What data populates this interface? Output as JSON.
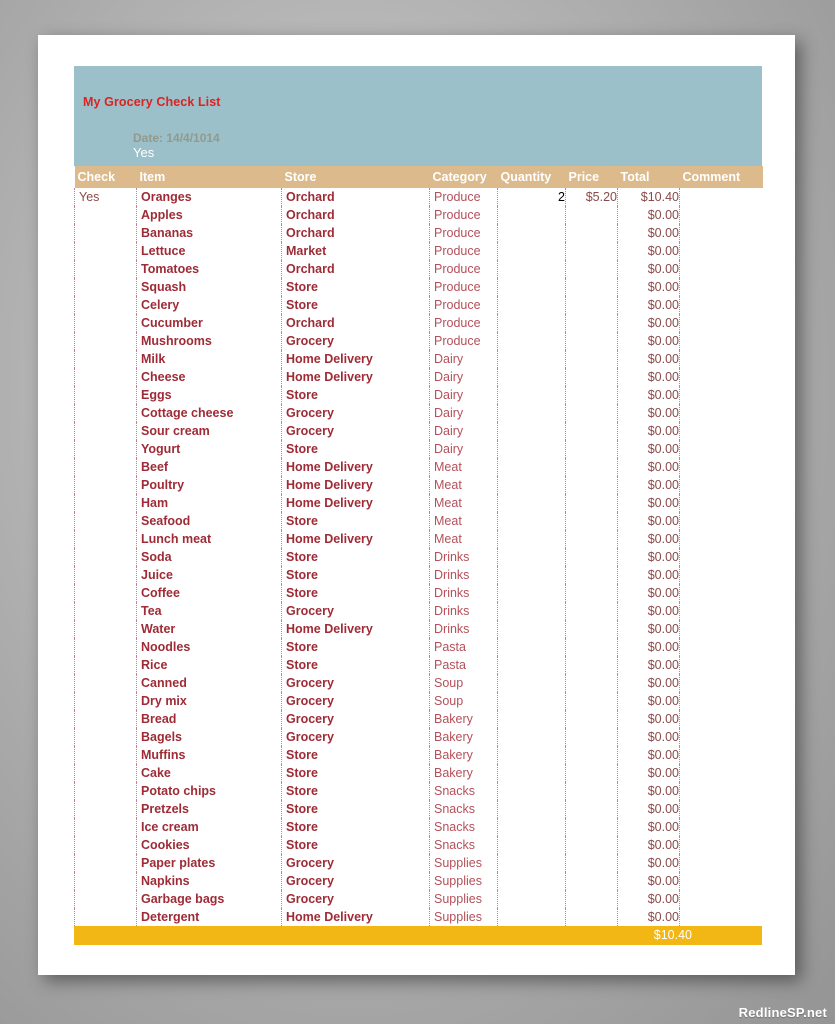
{
  "document": {
    "title": "My Grocery Check List",
    "date_label": "Date: 14/4/1014",
    "default_check": "Yes"
  },
  "colors": {
    "title_band": "#9bc0ca",
    "column_header_band": "#dcba8c",
    "total_bar": "#f2b714",
    "title_text": "#dd2222",
    "item_text": "#9e2b36",
    "category_text": "#b5505a",
    "page": "#ffffff",
    "backdrop": "#b8b8b8"
  },
  "table": {
    "columns": [
      {
        "key": "check",
        "label": "Check",
        "align": "left"
      },
      {
        "key": "item",
        "label": "Item",
        "align": "left"
      },
      {
        "key": "store",
        "label": "Store",
        "align": "left"
      },
      {
        "key": "category",
        "label": "Category",
        "align": "left"
      },
      {
        "key": "quantity",
        "label": "Quantity",
        "align": "right"
      },
      {
        "key": "price",
        "label": "Price",
        "align": "right"
      },
      {
        "key": "total",
        "label": "Total",
        "align": "right"
      },
      {
        "key": "comment",
        "label": "Comment",
        "align": "right"
      }
    ],
    "rows": [
      {
        "check": "Yes",
        "item": "Oranges",
        "store": "Orchard",
        "category": "Produce",
        "quantity": "2",
        "price": "$5.20",
        "total": "$10.40",
        "comment": ""
      },
      {
        "check": "",
        "item": "Apples",
        "store": "Orchard",
        "category": "Produce",
        "quantity": "",
        "price": "",
        "total": "$0.00",
        "comment": ""
      },
      {
        "check": "",
        "item": "Bananas",
        "store": "Orchard",
        "category": "Produce",
        "quantity": "",
        "price": "",
        "total": "$0.00",
        "comment": ""
      },
      {
        "check": "",
        "item": "Lettuce",
        "store": "Market",
        "category": "Produce",
        "quantity": "",
        "price": "",
        "total": "$0.00",
        "comment": ""
      },
      {
        "check": "",
        "item": "Tomatoes",
        "store": "Orchard",
        "category": "Produce",
        "quantity": "",
        "price": "",
        "total": "$0.00",
        "comment": ""
      },
      {
        "check": "",
        "item": "Squash",
        "store": "Store",
        "category": "Produce",
        "quantity": "",
        "price": "",
        "total": "$0.00",
        "comment": ""
      },
      {
        "check": "",
        "item": "Celery",
        "store": "Store",
        "category": "Produce",
        "quantity": "",
        "price": "",
        "total": "$0.00",
        "comment": ""
      },
      {
        "check": "",
        "item": "Cucumber",
        "store": "Orchard",
        "category": "Produce",
        "quantity": "",
        "price": "",
        "total": "$0.00",
        "comment": ""
      },
      {
        "check": "",
        "item": "Mushrooms",
        "store": "Grocery",
        "category": "Produce",
        "quantity": "",
        "price": "",
        "total": "$0.00",
        "comment": ""
      },
      {
        "check": "",
        "item": "Milk",
        "store": "Home Delivery",
        "category": "Dairy",
        "quantity": "",
        "price": "",
        "total": "$0.00",
        "comment": ""
      },
      {
        "check": "",
        "item": "Cheese",
        "store": "Home Delivery",
        "category": "Dairy",
        "quantity": "",
        "price": "",
        "total": "$0.00",
        "comment": ""
      },
      {
        "check": "",
        "item": "Eggs",
        "store": "Store",
        "category": "Dairy",
        "quantity": "",
        "price": "",
        "total": "$0.00",
        "comment": ""
      },
      {
        "check": "",
        "item": "Cottage cheese",
        "store": "Grocery",
        "category": "Dairy",
        "quantity": "",
        "price": "",
        "total": "$0.00",
        "comment": ""
      },
      {
        "check": "",
        "item": "Sour cream",
        "store": "Grocery",
        "category": "Dairy",
        "quantity": "",
        "price": "",
        "total": "$0.00",
        "comment": ""
      },
      {
        "check": "",
        "item": "Yogurt",
        "store": "Store",
        "category": "Dairy",
        "quantity": "",
        "price": "",
        "total": "$0.00",
        "comment": ""
      },
      {
        "check": "",
        "item": "Beef",
        "store": "Home Delivery",
        "category": "Meat",
        "quantity": "",
        "price": "",
        "total": "$0.00",
        "comment": ""
      },
      {
        "check": "",
        "item": "Poultry",
        "store": "Home Delivery",
        "category": "Meat",
        "quantity": "",
        "price": "",
        "total": "$0.00",
        "comment": ""
      },
      {
        "check": "",
        "item": "Ham",
        "store": "Home Delivery",
        "category": "Meat",
        "quantity": "",
        "price": "",
        "total": "$0.00",
        "comment": ""
      },
      {
        "check": "",
        "item": "Seafood",
        "store": "Store",
        "category": "Meat",
        "quantity": "",
        "price": "",
        "total": "$0.00",
        "comment": ""
      },
      {
        "check": "",
        "item": "Lunch meat",
        "store": "Home Delivery",
        "category": "Meat",
        "quantity": "",
        "price": "",
        "total": "$0.00",
        "comment": ""
      },
      {
        "check": "",
        "item": "Soda",
        "store": "Store",
        "category": "Drinks",
        "quantity": "",
        "price": "",
        "total": "$0.00",
        "comment": ""
      },
      {
        "check": "",
        "item": "Juice",
        "store": "Store",
        "category": "Drinks",
        "quantity": "",
        "price": "",
        "total": "$0.00",
        "comment": ""
      },
      {
        "check": "",
        "item": "Coffee",
        "store": "Store",
        "category": "Drinks",
        "quantity": "",
        "price": "",
        "total": "$0.00",
        "comment": ""
      },
      {
        "check": "",
        "item": "Tea",
        "store": "Grocery",
        "category": "Drinks",
        "quantity": "",
        "price": "",
        "total": "$0.00",
        "comment": ""
      },
      {
        "check": "",
        "item": "Water",
        "store": "Home Delivery",
        "category": "Drinks",
        "quantity": "",
        "price": "",
        "total": "$0.00",
        "comment": ""
      },
      {
        "check": "",
        "item": "Noodles",
        "store": "Store",
        "category": "Pasta",
        "quantity": "",
        "price": "",
        "total": "$0.00",
        "comment": ""
      },
      {
        "check": "",
        "item": "Rice",
        "store": "Store",
        "category": "Pasta",
        "quantity": "",
        "price": "",
        "total": "$0.00",
        "comment": ""
      },
      {
        "check": "",
        "item": "Canned",
        "store": "Grocery",
        "category": "Soup",
        "quantity": "",
        "price": "",
        "total": "$0.00",
        "comment": ""
      },
      {
        "check": "",
        "item": "Dry mix",
        "store": "Grocery",
        "category": "Soup",
        "quantity": "",
        "price": "",
        "total": "$0.00",
        "comment": ""
      },
      {
        "check": "",
        "item": "Bread",
        "store": "Grocery",
        "category": "Bakery",
        "quantity": "",
        "price": "",
        "total": "$0.00",
        "comment": ""
      },
      {
        "check": "",
        "item": "Bagels",
        "store": "Grocery",
        "category": "Bakery",
        "quantity": "",
        "price": "",
        "total": "$0.00",
        "comment": ""
      },
      {
        "check": "",
        "item": "Muffins",
        "store": "Store",
        "category": "Bakery",
        "quantity": "",
        "price": "",
        "total": "$0.00",
        "comment": ""
      },
      {
        "check": "",
        "item": "Cake",
        "store": "Store",
        "category": "Bakery",
        "quantity": "",
        "price": "",
        "total": "$0.00",
        "comment": ""
      },
      {
        "check": "",
        "item": "Potato chips",
        "store": "Store",
        "category": "Snacks",
        "quantity": "",
        "price": "",
        "total": "$0.00",
        "comment": ""
      },
      {
        "check": "",
        "item": "Pretzels",
        "store": "Store",
        "category": "Snacks",
        "quantity": "",
        "price": "",
        "total": "$0.00",
        "comment": ""
      },
      {
        "check": "",
        "item": "Ice cream",
        "store": "Store",
        "category": "Snacks",
        "quantity": "",
        "price": "",
        "total": "$0.00",
        "comment": ""
      },
      {
        "check": "",
        "item": "Cookies",
        "store": "Store",
        "category": "Snacks",
        "quantity": "",
        "price": "",
        "total": "$0.00",
        "comment": ""
      },
      {
        "check": "",
        "item": "Paper plates",
        "store": "Grocery",
        "category": "Supplies",
        "quantity": "",
        "price": "",
        "total": "$0.00",
        "comment": ""
      },
      {
        "check": "",
        "item": "Napkins",
        "store": "Grocery",
        "category": "Supplies",
        "quantity": "",
        "price": "",
        "total": "$0.00",
        "comment": ""
      },
      {
        "check": "",
        "item": "Garbage bags",
        "store": "Grocery",
        "category": "Supplies",
        "quantity": "",
        "price": "",
        "total": "$0.00",
        "comment": ""
      },
      {
        "check": "",
        "item": "Detergent",
        "store": "Home Delivery",
        "category": "Supplies",
        "quantity": "",
        "price": "",
        "total": "$0.00",
        "comment": ""
      }
    ],
    "grand_total": "$10.40"
  },
  "watermark": {
    "text": "RedlineSP.net"
  }
}
